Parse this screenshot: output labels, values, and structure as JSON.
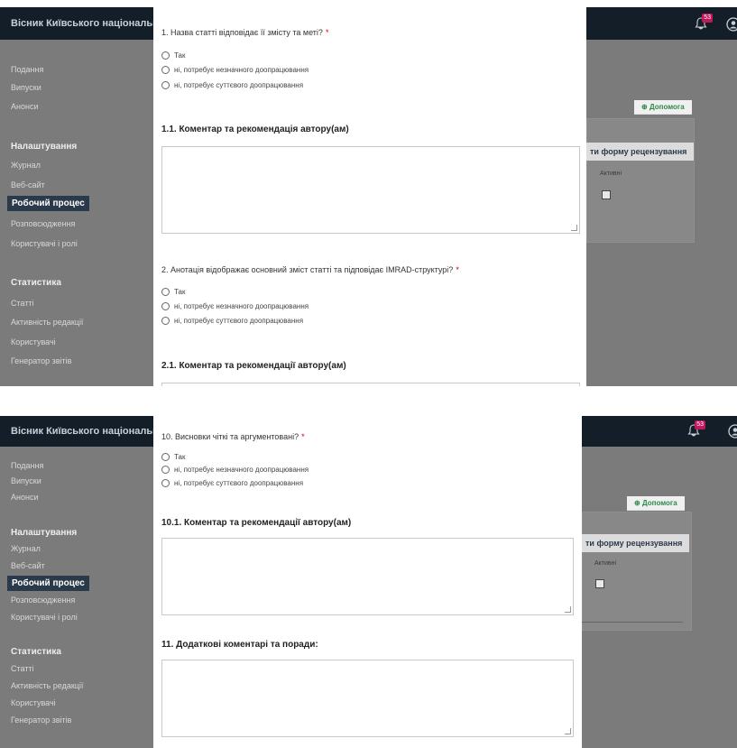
{
  "colors": {
    "topbar": "#141e29",
    "overlay": "#7b7b7b",
    "active_item": "#2b3a4a",
    "required": "#cc0000",
    "help_green": "#2f8a4a",
    "badge": "#c2175b"
  },
  "screens": [
    {
      "header": {
        "journal_title": "Вісник Київського національн",
        "notification_count": "53"
      },
      "sidebar": {
        "items_top": [
          "Подання",
          "Випуски",
          "Анонси"
        ],
        "settings_heading": "Налаштування",
        "settings_items": [
          "Журнал",
          "Веб-сайт",
          "Робочий процес",
          "Розповсюдження",
          "Користувачі і ролі"
        ],
        "stats_heading": "Статистика",
        "stats_items": [
          "Статті",
          "Активність редакції",
          "Користувачі",
          "Генератор звітів"
        ]
      },
      "background": {
        "help_tab": "Допомога",
        "button_label": "ти форму рецензування",
        "column_label": "Активні"
      },
      "form": [
        {
          "type": "question",
          "text": "1. Назва статті відповідає її змісту та меті?",
          "required": "*"
        },
        {
          "type": "options",
          "items": [
            "Так",
            "ні, потребує незначного доопрацювання",
            "ні, потребує суттєвого доопрацювання"
          ]
        },
        {
          "type": "heading",
          "text": "1.1. Коментар та рекомендація автору(ам)"
        },
        {
          "type": "question",
          "text": "2. Анотація відображає основний зміст статті та підповідає IMRAD-структурі?",
          "required": "*"
        },
        {
          "type": "options",
          "items": [
            "Так",
            "ні, потребує незначного доопрацювання",
            "ні, потребує суттєвого доопрацювання"
          ]
        },
        {
          "type": "heading",
          "text": "2.1. Коментар та рекомендації автору(ам)"
        }
      ]
    },
    {
      "header": {
        "journal_title": "Вісник Київського національн",
        "notification_count": "53"
      },
      "sidebar": {
        "items_top": [
          "Подання",
          "Випуски",
          "Анонси"
        ],
        "settings_heading": "Налаштування",
        "settings_items": [
          "Журнал",
          "Веб-сайт",
          "Робочий процес",
          "Розповсюдження",
          "Користувачі і ролі"
        ],
        "stats_heading": "Статистика",
        "stats_items": [
          "Статті",
          "Активність редакції",
          "Користувачі",
          "Генератор звітів"
        ]
      },
      "background": {
        "help_tab": "Допомога",
        "button_label": "ти форму рецензування",
        "column_label": "Активні"
      },
      "form": [
        {
          "type": "question",
          "text": "10. Висновки чіткі та аргументовані?",
          "required": "*"
        },
        {
          "type": "options",
          "items": [
            "Так",
            "ні, потребує незначного доопрацювання",
            "ні, потребує суттєвого доопрацювання"
          ]
        },
        {
          "type": "heading",
          "text": "10.1. Коментар та рекомендації автору(ам)"
        },
        {
          "type": "heading",
          "text": "11. Додаткові коментарі та поради:"
        }
      ]
    }
  ]
}
